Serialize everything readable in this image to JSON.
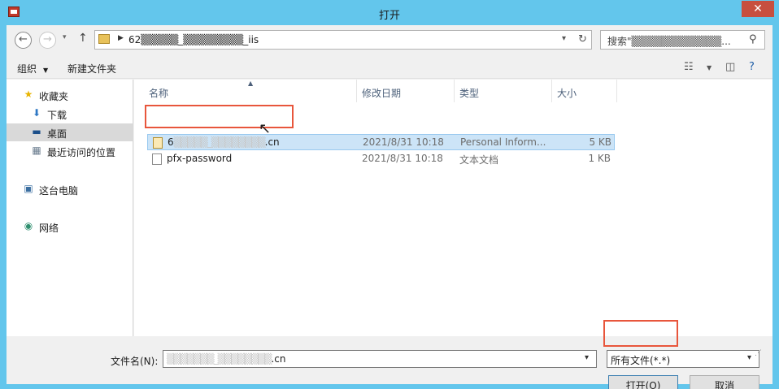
{
  "window": {
    "title": "打开",
    "close_glyph": "✕"
  },
  "nav": {
    "address_path": "62▒▒▒▒▒_▒▒▒▒▒▒▒▒_iis",
    "search_placeholder": "搜索\"▒▒▒▒▒▒▒▒▒▒▒▒...",
    "back_glyph": "←",
    "forward_glyph": "→",
    "up_glyph": "↑",
    "dropdown_glyph": "▾",
    "refresh_glyph": "↻",
    "search_glyph": "⚲"
  },
  "toolbar": {
    "organize_label": "组织",
    "new_folder_label": "新建文件夹",
    "caret": "▼"
  },
  "sidebar": {
    "items": [
      {
        "label": "收藏夹",
        "icon": "star-icon",
        "glyph": "★",
        "color": "#e8b400"
      },
      {
        "label": "下载",
        "icon": "download-folder-icon",
        "glyph": "⬇",
        "color": "#2f78c4"
      },
      {
        "label": "桌面",
        "icon": "desktop-icon",
        "glyph": "▬",
        "color": "#1c4f8a"
      },
      {
        "label": "最近访问的位置",
        "icon": "recent-places-icon",
        "glyph": "▦",
        "color": "#6b7d8f"
      },
      {
        "label": "这台电脑",
        "icon": "computer-icon",
        "glyph": "▣",
        "color": "#3b6ea0"
      },
      {
        "label": "网络",
        "icon": "network-icon",
        "glyph": "◉",
        "color": "#2f8f6f"
      }
    ]
  },
  "columns": {
    "name": "名称",
    "modified": "修改日期",
    "type": "类型",
    "size": "大小",
    "sort_glyph": "▲"
  },
  "files": [
    {
      "name_prefix": "6",
      "name_blur": "▒▒▒▒▒_▒▒▒▒▒▒▒▒",
      "name_suffix": ".cn",
      "modified": "2021/8/31 10:18",
      "type": "Personal Inform...",
      "size": "5 KB"
    },
    {
      "name_prefix": "pfx-password",
      "name_blur": "",
      "name_suffix": "",
      "modified": "2021/8/31 10:18",
      "type": "文本文档",
      "size": "1 KB"
    }
  ],
  "footer": {
    "filename_label": "文件名(N):",
    "filename_blur": "▒▒▒▒▒▒▒_▒▒▒▒▒▒▒▒",
    "filename_suffix": ".cn",
    "filetype_value": "所有文件(*.*)",
    "open_label": "打开(O)",
    "cancel_label": "取消"
  },
  "colors": {
    "title_bar": "#63c6ec",
    "close_button": "#c74f3f",
    "selection": "#cce4f7",
    "highlight": "#e8563c"
  }
}
